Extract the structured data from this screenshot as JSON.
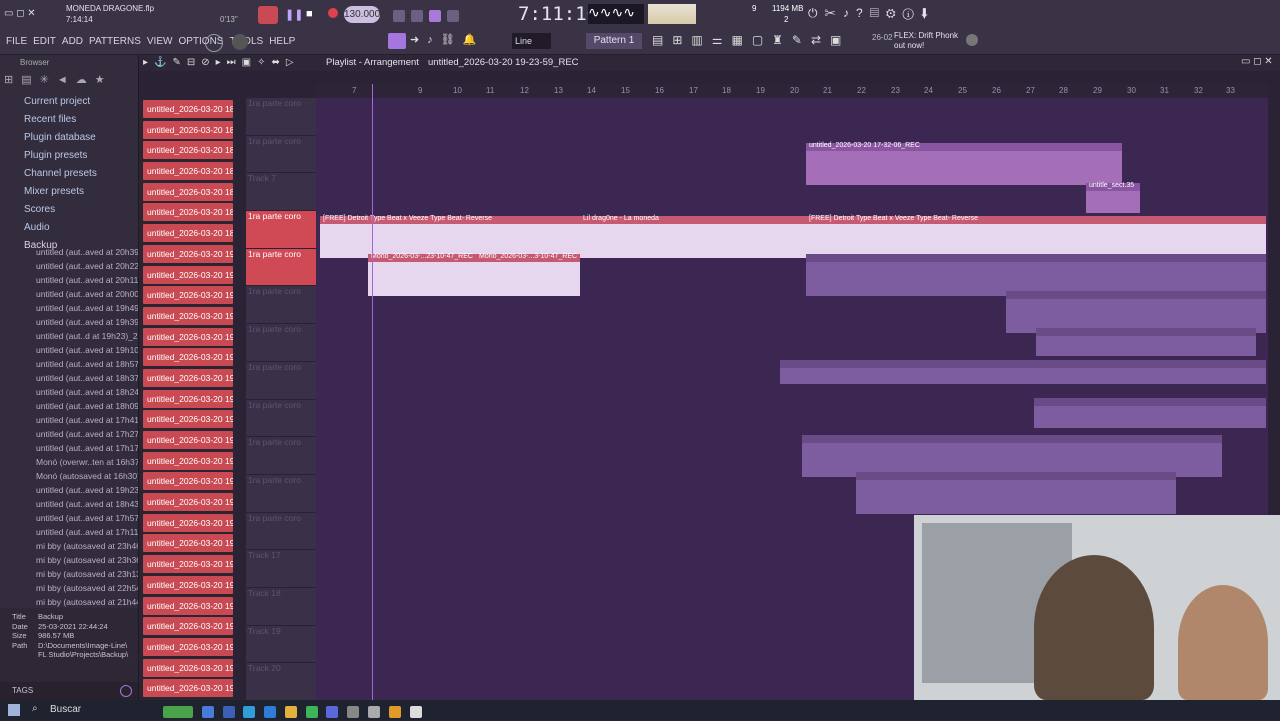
{
  "window": {
    "title": "MONEDA DRAGONE.flp",
    "time_small": "7:14:14",
    "time_sub": "0'13\""
  },
  "transport": {
    "tempo": "130.000",
    "time": "7:11:10",
    "pattern": "Pattern 1",
    "mode": "Line",
    "cpu": "9",
    "ram": "1194 MB",
    "voices": "2"
  },
  "news": {
    "date": "26-02",
    "text": "FLEX: Drift Phonk out now!"
  },
  "menu": [
    "FILE",
    "EDIT",
    "ADD",
    "PATTERNS",
    "VIEW",
    "OPTIONS",
    "TOOLS",
    "HELP"
  ],
  "browser": {
    "label": "Browser",
    "items": [
      "Current project",
      "Recent files",
      "Plugin database",
      "Plugin presets",
      "Channel presets",
      "Mixer presets",
      "Scores",
      "Audio",
      "Backup"
    ],
    "backups": [
      "untitled (aut..aved at 20h39)",
      "untitled (aut..aved at 20h22)",
      "untitled (aut..aved at 20h11)",
      "untitled (aut..aved at 20h00)",
      "untitled (aut..aved at 19h49)",
      "untitled (aut..aved at 19h39)",
      "untitled (aut..d at 19h23)_2",
      "untitled (aut..aved at 19h10)",
      "untitled (aut..aved at 18h57)",
      "untitled (aut..aved at 18h37)",
      "untitled (aut..aved at 18h24)",
      "untitled (aut..aved at 18h09)",
      "untitled (aut..aved at 17h41)",
      "untitled (aut..aved at 17h27)",
      "untitled (aut..aved at 17h17)",
      "Monó (overwr..ten at 16h37)",
      "Monó (autosaved at 16h30)",
      "untitled (aut..aved at 19h23)",
      "untitled (aut..aved at 18h43)",
      "untitled (aut..aved at 17h57)",
      "untitled (aut..aved at 17h11)",
      "mi bby (autosaved at 23h46)",
      "mi bby (autosaved at 23h36)",
      "mi bby (autosaved at 23h13)",
      "mi bby (autosaved at 22h54)",
      "mi bby (autosaved at 21h44)"
    ],
    "info": {
      "title_label": "Title",
      "title": "Backup",
      "date_label": "Date",
      "date": "25-03-2021 22:44:24",
      "size_label": "Size",
      "size": "986.57 MB",
      "path_label": "Path",
      "path": "D:\\Documents\\Image-Line\\ FL Studio\\Projects\\Backup\\"
    },
    "tags": "TAGS"
  },
  "playlist": {
    "title": "Playlist - Arrangement",
    "pattern_name": "untitled_2026-03-20 19-23-59_REC",
    "ruler": [
      "7",
      "9",
      "10",
      "11",
      "12",
      "13",
      "14",
      "15",
      "16",
      "17",
      "18",
      "19",
      "20",
      "21",
      "22",
      "23",
      "24",
      "25",
      "26",
      "27",
      "28",
      "29",
      "30",
      "31",
      "32",
      "33"
    ],
    "channels": [
      "untitled_2026-03-20 18-",
      "untitled_2026-03-20 18-",
      "untitled_2026-03-20 18-",
      "untitled_2026-03-20 18-",
      "untitled_2026-03-20 18-",
      "untitled_2026-03-20 18-",
      "untitled_2026-03-20 18-",
      "untitled_2026-03-20 19-",
      "untitled_2026-03-20 19-",
      "untitled_2026-03-20 19-",
      "untitled_2026-03-20 19-",
      "untitled_2026-03-20 19-",
      "untitled_2026-03-20 19-",
      "untitled_2026-03-20 19-",
      "untitled_2026-03-20 19-",
      "untitled_2026-03-20 19-",
      "untitled_2026-03-20 19-",
      "untitled_2026-03-20 19-",
      "untitled_2026-03-20 19-",
      "untitled_2026-03-20 19-",
      "untitled_2026-03-20 19-",
      "untitled_2026-03-20 19-",
      "untitled_2026-03-20 19-",
      "untitled_2026-03-20 19-",
      "untitled_2026-03-20 19-",
      "untitled_2026-03-20 19-",
      "untitled_2026-03-20 19-",
      "untitled_2026-03-20 19-",
      "untitled_2026-03-20 19-"
    ],
    "tracks": [
      "1ra parte coro",
      "1ra parte coro",
      "Track 7",
      "1ra parte coro",
      "1ra parte coro",
      "1ra parte coro",
      "1ra parte coro",
      "1ra parte coro",
      "1ra parte coro",
      "1ra parte coro",
      "1ra parte coro",
      "1ra parte coro",
      "Track 17",
      "Track 18",
      "Track 19",
      "Track 20",
      "Track 21"
    ],
    "clips": [
      "[FREE] Detroit Type Beat x Veeze Type Beat- Reverse",
      "Lil drag0ne - La moneda",
      "[FREE] Detroit Type Beat x Veeze Type Beat- Reverse",
      "Mono_2026-03-...23-10-47_REC",
      "Mono_2026-03-...3-10-47_REC",
      "untitled_2026-03-20 17-32-06_REC",
      "untitle_sect.35"
    ]
  },
  "taskbar": {
    "search": "Buscar"
  }
}
